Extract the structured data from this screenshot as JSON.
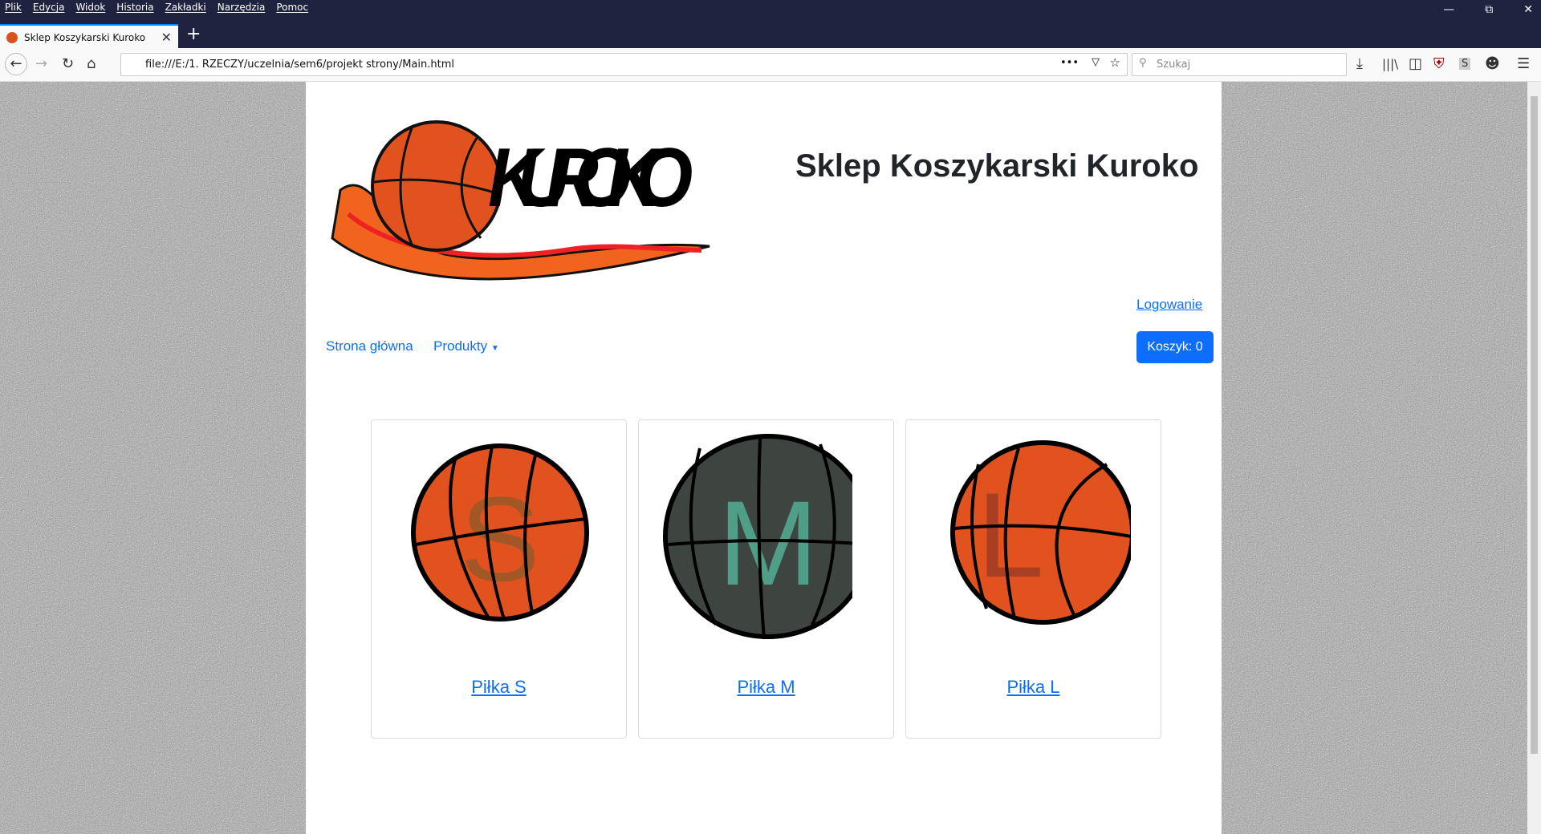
{
  "browser": {
    "menu": [
      "Plik",
      "Edycja",
      "Widok",
      "Historia",
      "Zakładki",
      "Narzędzia",
      "Pomoc"
    ],
    "tab_title": "Sklep Koszykarski Kuroko",
    "url": "file:///E:/1. RZECZY/uczelnia/sem6/projekt strony/Main.html",
    "search_placeholder": "Szukaj"
  },
  "header": {
    "logo_text": "KUROKO",
    "title": "Sklep Koszykarski Kuroko",
    "login": "Logowanie"
  },
  "nav": {
    "home": "Strona główna",
    "products": "Produkty",
    "cart": "Koszyk: 0"
  },
  "products": [
    {
      "name": "Piłka S",
      "letter": "S",
      "ball_color": "#e2521e",
      "letter_color": "#8a5a2a"
    },
    {
      "name": "Piłka M",
      "letter": "M",
      "ball_color": "#3e4541",
      "letter_color": "#4f9e88"
    },
    {
      "name": "Piłka L",
      "letter": "L",
      "ball_color": "#e2521e",
      "letter_color": "#9a3a24"
    }
  ]
}
